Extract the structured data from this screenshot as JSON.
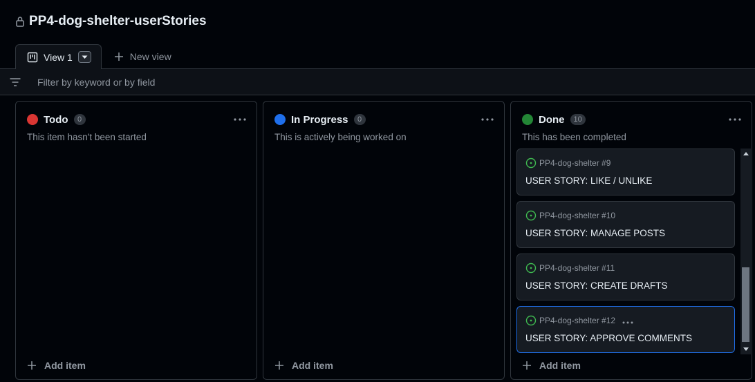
{
  "project": {
    "title": "PP4-dog-shelter-userStories"
  },
  "tabs": {
    "active_label": "View 1",
    "new_view_label": "New view"
  },
  "filter": {
    "placeholder": "Filter by keyword or by field"
  },
  "columns": [
    {
      "name": "Todo",
      "count": "0",
      "description": "This item hasn't been started",
      "color": "#da3633",
      "add_item_label": "Add item"
    },
    {
      "name": "In Progress",
      "count": "0",
      "description": "This is actively being worked on",
      "color": "#1f6feb",
      "add_item_label": "Add item"
    },
    {
      "name": "Done",
      "count": "10",
      "description": "This has been completed",
      "color": "#238636",
      "add_item_label": "Add item",
      "cards": [
        {
          "repo_ref": "PP4-dog-shelter #9",
          "title": "USER STORY: LIKE / UNLIKE"
        },
        {
          "repo_ref": "PP4-dog-shelter #10",
          "title": "USER STORY: MANAGE POSTS"
        },
        {
          "repo_ref": "PP4-dog-shelter #11",
          "title": "USER STORY: CREATE DRAFTS"
        },
        {
          "repo_ref": "PP4-dog-shelter #12",
          "title": "USER STORY: APPROVE COMMENTS"
        }
      ]
    }
  ],
  "colors": {
    "background": "#010409",
    "border": "#30363d",
    "accent": "#1f6feb",
    "issue_open": "#3fb950"
  }
}
